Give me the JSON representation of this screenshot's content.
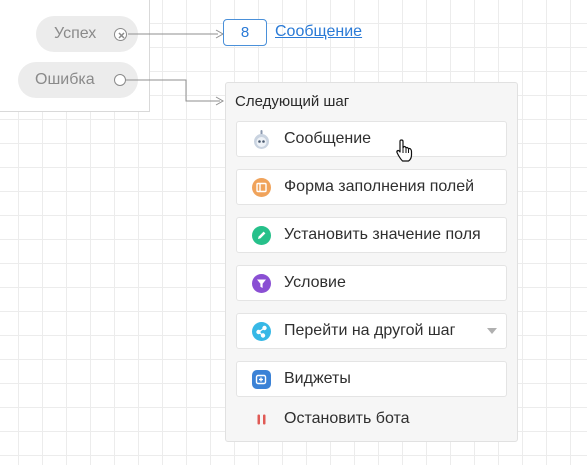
{
  "source_node": {
    "outlets": [
      {
        "label": "Успех",
        "port": "x-circle-icon"
      },
      {
        "label": "Ошибка",
        "port": "empty-circle-icon"
      }
    ]
  },
  "success_target": {
    "step_number": "8",
    "link_text": "Сообщение"
  },
  "next_step_menu": {
    "title": "Следующий шаг",
    "items": [
      {
        "label": "Сообщение",
        "icon": "robot-icon",
        "icon_color": "#9aa7b8"
      },
      {
        "label": "Форма заполнения полей",
        "icon": "form-icon",
        "icon_color": "#f0a35b"
      },
      {
        "label": "Установить значение поля",
        "icon": "pencil-icon",
        "icon_color": "#26c08a"
      },
      {
        "label": "Условие",
        "icon": "filter-icon",
        "icon_color": "#8a4fd3"
      },
      {
        "label": "Перейти на другой шаг",
        "icon": "share-icon",
        "icon_color": "#37b8e6"
      },
      {
        "label": "Виджеты",
        "icon": "widget-icon",
        "icon_color": "#3b82d6"
      },
      {
        "label": "Остановить бота",
        "icon": "pause-icon",
        "icon_color": "#e05a55"
      }
    ]
  }
}
